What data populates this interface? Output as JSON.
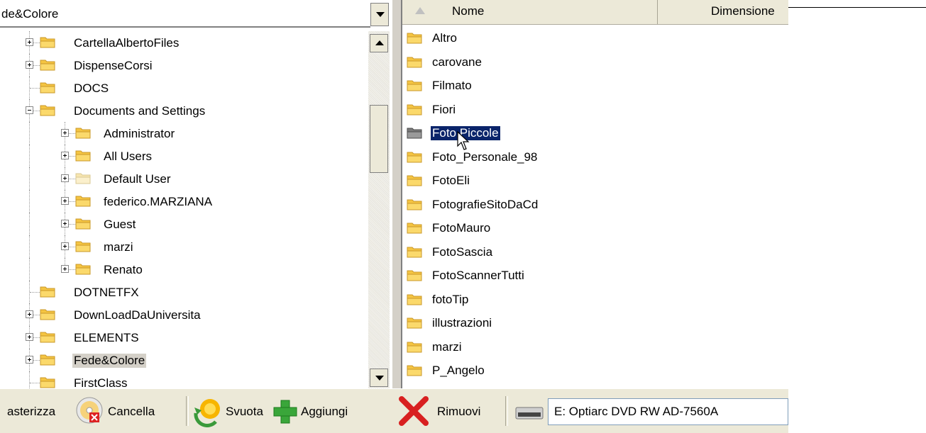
{
  "tree": {
    "path_value": "de&Colore",
    "items": [
      {
        "label": "CartellaAlbertoFiles",
        "depth": 0,
        "expander": "plus"
      },
      {
        "label": "DispenseCorsi",
        "depth": 0,
        "expander": "plus"
      },
      {
        "label": "DOCS",
        "depth": 0,
        "expander": "none"
      },
      {
        "label": "Documents and Settings",
        "depth": 0,
        "expander": "minus"
      },
      {
        "label": "Administrator",
        "depth": 1,
        "expander": "plus"
      },
      {
        "label": "All Users",
        "depth": 1,
        "expander": "plus"
      },
      {
        "label": "Default User",
        "depth": 1,
        "expander": "plus",
        "faded": true
      },
      {
        "label": "federico.MARZIANA",
        "depth": 1,
        "expander": "plus"
      },
      {
        "label": "Guest",
        "depth": 1,
        "expander": "plus"
      },
      {
        "label": "marzi",
        "depth": 1,
        "expander": "plus"
      },
      {
        "label": "Renato",
        "depth": 1,
        "expander": "plus"
      },
      {
        "label": "DOTNETFX",
        "depth": 0,
        "expander": "none"
      },
      {
        "label": "DownLoadDaUniversita",
        "depth": 0,
        "expander": "plus"
      },
      {
        "label": "ELEMENTS",
        "depth": 0,
        "expander": "plus"
      },
      {
        "label": "Fede&Colore",
        "depth": 0,
        "expander": "plus",
        "selected": true
      },
      {
        "label": "FirstClass",
        "depth": 0,
        "expander": "none"
      }
    ]
  },
  "files": {
    "columns": [
      {
        "label": "Nome",
        "sorted": true
      },
      {
        "label": "Dimensione"
      }
    ],
    "items": [
      {
        "name": "Altro"
      },
      {
        "name": "carovane"
      },
      {
        "name": "Filmato"
      },
      {
        "name": "Fiori"
      },
      {
        "name": "Foto Piccole",
        "selected": true
      },
      {
        "name": "Foto_Personale_98"
      },
      {
        "name": "FotoEli"
      },
      {
        "name": "FotografieSitoDaCd"
      },
      {
        "name": "FotoMauro"
      },
      {
        "name": "FotoSascia"
      },
      {
        "name": "FotoScannerTutti"
      },
      {
        "name": "fotoTip"
      },
      {
        "name": "illustrazioni"
      },
      {
        "name": "marzi"
      },
      {
        "name": "P_Angelo"
      }
    ]
  },
  "toolbar": {
    "masterizza_label": "asterizza",
    "cancella_label": "Cancella",
    "svuota_label": "Svuota",
    "aggiungi_label": "Aggiungi",
    "rimuovi_label": "Rimuovi",
    "drive_value": "E: Optiarc DVD RW AD-7560A"
  },
  "colors": {
    "folder": "#f5c542",
    "selection": "#0a246a",
    "toolbar_bg": "#ece9d8"
  }
}
